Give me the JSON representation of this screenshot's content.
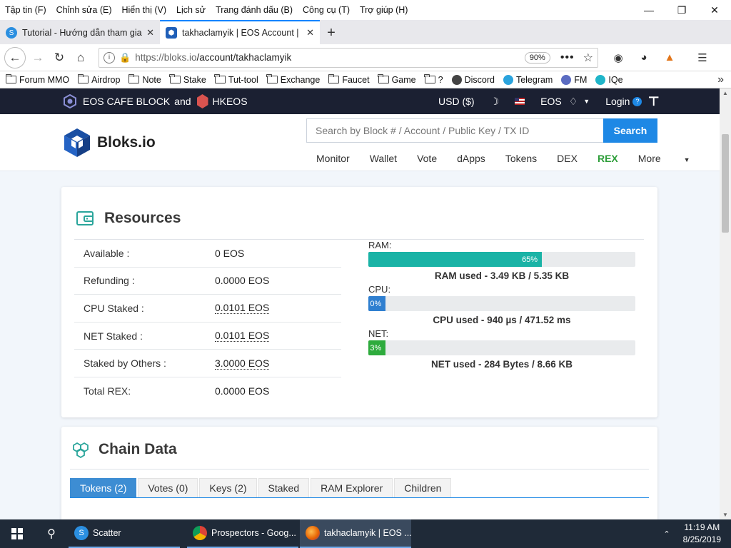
{
  "menu": [
    "Tập tin (F)",
    "Chỉnh sửa (E)",
    "Hiển thị (V)",
    "Lịch sử",
    "Trang đánh dấu (B)",
    "Công cụ (T)",
    "Trợ giúp (H)"
  ],
  "tabs": [
    {
      "label": "Tutorial - Hướng dẫn tham gia",
      "icon": "scatter-icon",
      "color": "#2b8fe0"
    },
    {
      "label": "takhaclamyik | EOS Account | B",
      "icon": "bloks-icon",
      "color": "#1f5fb8"
    }
  ],
  "nav": {
    "url_prefix": "https://bloks.io",
    "url_path": "/account/takhaclamyik",
    "zoom": "90%"
  },
  "bookmarks": [
    {
      "label": "Forum MMO",
      "type": "folder"
    },
    {
      "label": "Airdrop",
      "type": "folder"
    },
    {
      "label": "Note",
      "type": "folder"
    },
    {
      "label": "Stake",
      "type": "folder"
    },
    {
      "label": "Tut-tool",
      "type": "folder"
    },
    {
      "label": "Exchange",
      "type": "folder"
    },
    {
      "label": "Faucet",
      "type": "folder"
    },
    {
      "label": "Game",
      "type": "folder"
    },
    {
      "label": "?",
      "type": "folder"
    },
    {
      "label": "Discord",
      "type": "icon",
      "color": "#444"
    },
    {
      "label": "Telegram",
      "type": "icon",
      "color": "#2aa3dd"
    },
    {
      "label": "FM",
      "type": "icon",
      "color": "#5b6cc2"
    },
    {
      "label": "IQe",
      "type": "icon",
      "color": "#1fb5c9"
    }
  ],
  "site": {
    "producer_text": "EOS CAFE BLOCK",
    "and_text": "and",
    "producer_text2": "HKEOS",
    "currency": "USD ($)",
    "network": "EOS",
    "login": "Login",
    "brand": "Bloks.io",
    "search_placeholder": "Search by Block # / Account / Public Key / TX ID",
    "search_button": "Search",
    "menu": [
      "Monitor",
      "Wallet",
      "Vote",
      "dApps",
      "Tokens",
      "DEX",
      "REX",
      "More"
    ]
  },
  "resources": {
    "title": "Resources",
    "rows": [
      {
        "label": "Available :",
        "value": "0 EOS",
        "dotted": false
      },
      {
        "label": "Refunding :",
        "value": "0.0000 EOS",
        "dotted": false
      },
      {
        "label": "CPU Staked :",
        "value": "0.0101 EOS",
        "dotted": true
      },
      {
        "label": "NET Staked :",
        "value": "0.0101 EOS",
        "dotted": true
      },
      {
        "label": "Staked by Others :",
        "value": "3.0000 EOS",
        "dotted": true
      },
      {
        "label": "Total REX:",
        "value": "0.0000 EOS",
        "dotted": false
      }
    ],
    "meters": [
      {
        "label": "RAM:",
        "percent": 65,
        "percent_text": "65%",
        "color": "#1ab3a6",
        "caption": "RAM used - 3.49 KB / 5.35 KB"
      },
      {
        "label": "CPU:",
        "percent": 0,
        "percent_text": "0%",
        "color": "#2f7fd0",
        "caption": "CPU used - 940 µs / 471.52 ms"
      },
      {
        "label": "NET:",
        "percent": 3,
        "percent_text": "3%",
        "color": "#2eab3d",
        "caption": "NET used - 284 Bytes / 8.66 KB"
      }
    ]
  },
  "chain": {
    "title": "Chain Data",
    "tabs": [
      "Tokens (2)",
      "Votes (0)",
      "Keys (2)",
      "Staked",
      "RAM Explorer",
      "Children"
    ]
  },
  "taskbar": {
    "items": [
      {
        "label": "Scatter",
        "color": "#2b8fe0"
      },
      {
        "label": "Prospectors - Goog...",
        "color": "#e04a3a"
      },
      {
        "label": "takhaclamyik | EOS ...",
        "color": "#e66000"
      }
    ],
    "time": "11:19 AM",
    "date": "8/25/2019"
  }
}
